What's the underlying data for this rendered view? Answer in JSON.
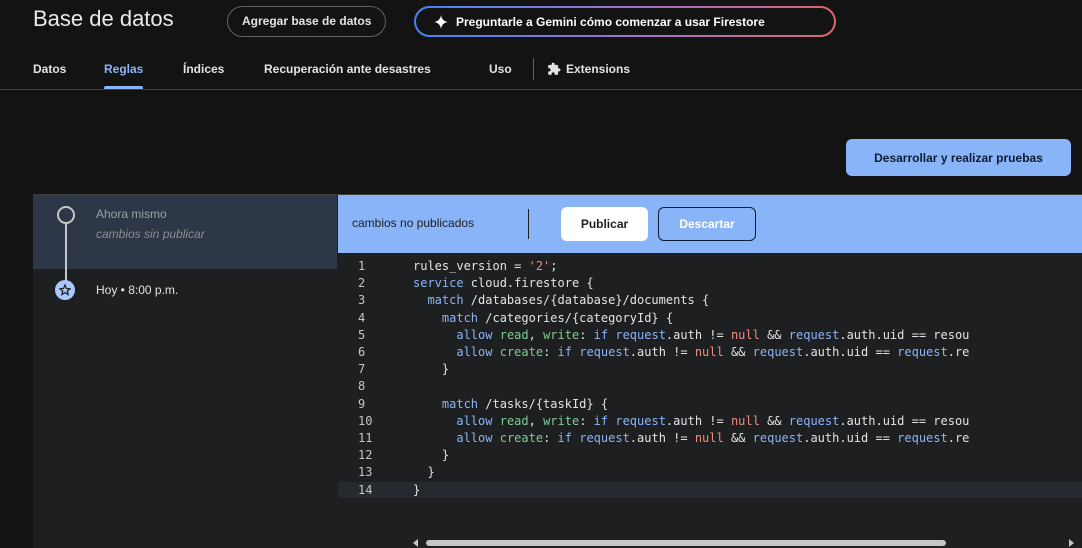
{
  "header": {
    "title": "Base de datos",
    "add_db_label": "Agregar base de datos",
    "gemini_label": "Preguntarle a Gemini cómo comenzar a usar Firestore"
  },
  "tabs": [
    {
      "label": "Datos",
      "active": false
    },
    {
      "label": "Reglas",
      "active": true
    },
    {
      "label": "Índices",
      "active": false
    },
    {
      "label": "Recuperación ante desastres",
      "active": false
    },
    {
      "label": "Uso",
      "active": false
    },
    {
      "label": "Extensions",
      "active": false
    }
  ],
  "actions": {
    "develop_label": "Desarrollar y realizar pruebas"
  },
  "history": {
    "items": [
      {
        "title": "Ahora mismo",
        "subtitle": "cambios sin publicar"
      },
      {
        "title": "Hoy • 8:00 p.m."
      }
    ]
  },
  "editor": {
    "status_label": "cambios no publicados",
    "publish_label": "Publicar",
    "discard_label": "Descartar",
    "line_numbers": [
      "1",
      "2",
      "3",
      "4",
      "5",
      "6",
      "7",
      "8",
      "9",
      "10",
      "11",
      "12",
      "13",
      "14"
    ],
    "lines": [
      "rules_version = '2';",
      "service cloud.firestore {",
      "  match /databases/{database}/documents {",
      "    match /categories/{categoryId} {",
      "      allow read, write: if request.auth != null && request.auth.uid == resou",
      "      allow create: if request.auth != null && request.auth.uid == request.re",
      "    }",
      "",
      "    match /tasks/{taskId} {",
      "      allow read, write: if request.auth != null && request.auth.uid == resou",
      "      allow create: if request.auth != null && request.auth.uid == request.re",
      "    }",
      "  }",
      "}"
    ]
  },
  "colors": {
    "accent": "#8ab4f8",
    "background": "#131314",
    "panel": "#1e1f20"
  }
}
